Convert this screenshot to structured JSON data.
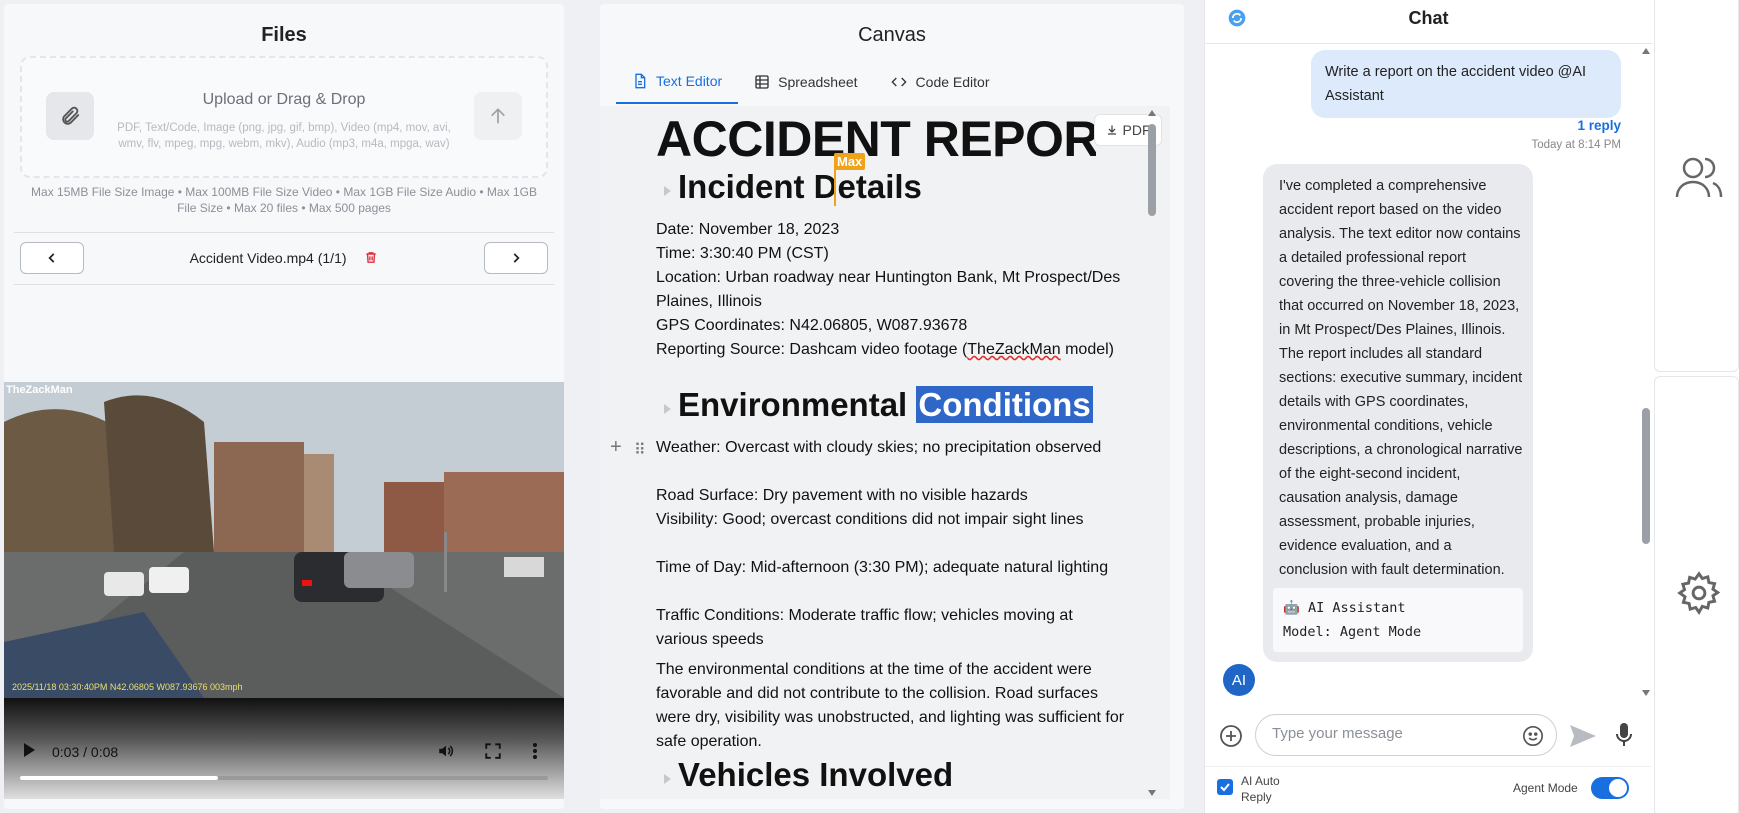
{
  "files": {
    "title": "Files",
    "upload_title": "Upload or Drag & Drop",
    "upload_types": "PDF, Text/Code, Image (png, jpg, gif, bmp), Video (mp4, mov, avi, wmv, flv, mpeg, mpg, webm, mkv), Audio (mp3, m4a, mpga, wav)",
    "limits": "Max 15MB File Size Image • Max 100MB File Size Video • Max 1GB File Size Audio • Max 1GB File Size • Max 20 files • Max 500 pages",
    "current_file": "Accident Video.mp4 (1/1)",
    "video": {
      "watermark": "TheZackMan",
      "overlay_timestamp": "2025/11/18 03:30:40PM N42.06805 W087.93676 003mph",
      "time": "0:03 / 0:08",
      "progress": 0.375
    }
  },
  "canvas": {
    "title": "Canvas",
    "tabs": [
      {
        "label": "Text Editor",
        "active": true,
        "icon": "document-icon"
      },
      {
        "label": "Spreadsheet",
        "active": false,
        "icon": "table-icon"
      },
      {
        "label": "Code Editor",
        "active": false,
        "icon": "code-icon"
      }
    ],
    "pdf_label": "PDF",
    "collaborator_cursor": "Max",
    "doc": {
      "title": "ACCIDENT REPORT",
      "h_incident": "Incident Details",
      "incident_lines": [
        "Date: November 18, 2023",
        "Time: 3:30:40 PM (CST)",
        "Location: Urban roadway near Huntington Bank, Mt Prospect/Des Plaines, Illinois",
        "GPS Coordinates: N42.06805, W087.93678",
        "Reporting Source: Dashcam video footage (TheZackMan model)"
      ],
      "h_env_1": "Environmental",
      "h_env_2": "Conditions",
      "env_lines": [
        "Weather: Overcast with cloudy skies; no precipitation observed",
        "Road Surface: Dry pavement with no visible hazards",
        "Visibility: Good; overcast conditions did not impair sight lines",
        "Time of Day: Mid-afternoon (3:30 PM); adequate natural lighting",
        "Traffic Conditions: Moderate traffic flow; vehicles moving at various speeds"
      ],
      "env_paragraph": "The environmental conditions at the time of the accident were favorable and did not contribute to the collision. Road surfaces were dry, visibility was unobstructed, and lighting was sufficient for safe operation.",
      "h_vehicles": "Vehicles Involved"
    }
  },
  "chat": {
    "title": "Chat",
    "user_message": "Write a report on the accident video @AI Assistant",
    "reply_count": "1 reply",
    "timestamp": "Today at 8:14 PM",
    "ai_message_p1": "I've completed a comprehensive accident report based on the video analysis. The text editor now contains a detailed professional report covering the three-vehicle collision that occurred on November 18, 2023, in Mt Prospect/Des Plaines, Illinois.",
    "ai_message_p2": "The report includes all standard sections: executive summary, incident details with GPS coordinates, environmental conditions, vehicle descriptions, a chronological narrative of the eight-second incident, causation analysis, damage assessment, probable injuries, evidence evaluation, and a conclusion with fault determination.",
    "ai_signature_name": "AI Assistant",
    "ai_signature_model": "Model: Agent Mode",
    "avatar_initials": "AI",
    "input_placeholder": "Type your message",
    "auto_reply_label": "AI Auto Reply",
    "agent_mode_label": "Agent Mode",
    "auto_reply_checked": true,
    "agent_mode_on": true
  },
  "rail": {
    "icons": [
      "users-icon",
      "gear-icon"
    ]
  },
  "colors": {
    "accent": "#1a6fe0",
    "highlight": "#2f67c8",
    "cursor": "#f0a21a",
    "delete": "#e0303a"
  }
}
